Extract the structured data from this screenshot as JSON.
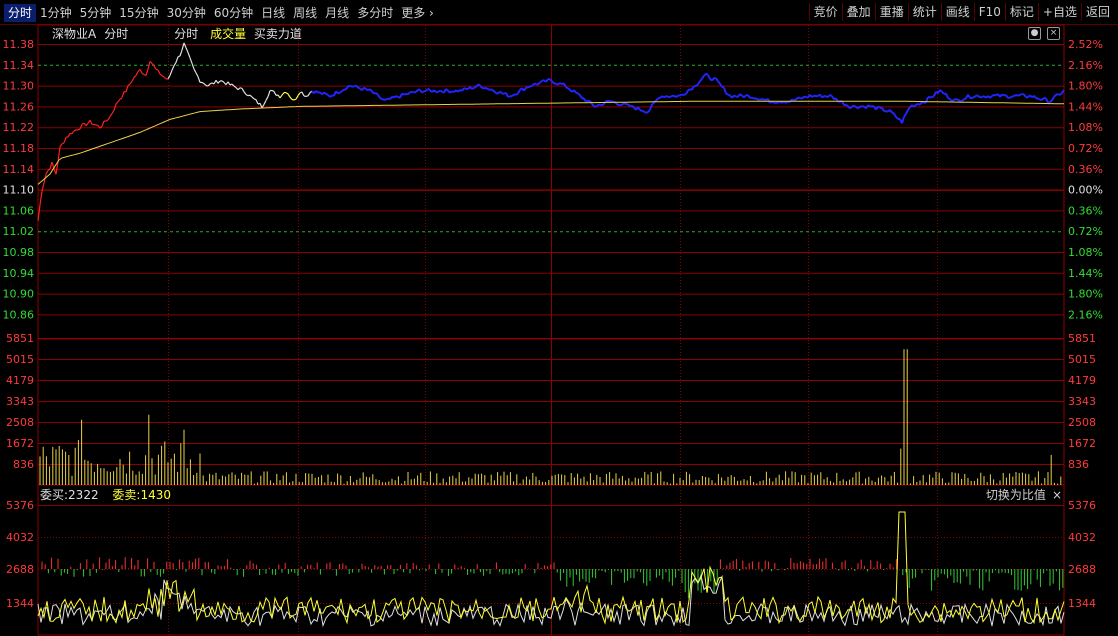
{
  "toolbar": {
    "tabs": [
      "分时",
      "1分钟",
      "5分钟",
      "15分钟",
      "30分钟",
      "60分钟",
      "日线",
      "周线",
      "月线",
      "多分时",
      "更多"
    ],
    "active_tab": 0,
    "right_buttons": [
      "竞价",
      "叠加",
      "重播",
      "统计",
      "画线",
      "F10",
      "标记",
      "+自选",
      "返回"
    ]
  },
  "info": {
    "stock_name": "深物业A",
    "period": "分时",
    "label_period2": "分时",
    "label_volume": "成交量",
    "label_force": "买卖力道"
  },
  "colors": {
    "grid": "#8b0000",
    "dash": "#2ea82e",
    "price_up": "#ff2020",
    "price_flat": "#e0e0e0",
    "price_down": "#2424ff",
    "price_yellow": "#ffff33",
    "avg": "#e8d24a",
    "axis_red": "#ff3b3b",
    "axis_green": "#33dd33",
    "axis_white": "#e0e0e0"
  },
  "price_axis": {
    "left_labels": [
      "11.38",
      "11.34",
      "11.30",
      "11.26",
      "11.22",
      "11.18",
      "11.14",
      "11.10",
      "11.06",
      "11.02",
      "10.98",
      "10.94",
      "10.90",
      "10.86"
    ],
    "right_labels": [
      "2.52%",
      "2.16%",
      "1.80%",
      "1.44%",
      "1.08%",
      "0.72%",
      "0.36%",
      "0.00%",
      "0.36%",
      "0.72%",
      "1.08%",
      "1.44%",
      "1.80%",
      "2.16%"
    ],
    "pre_close": 11.1
  },
  "volume_axis": {
    "labels": [
      "5851",
      "5015",
      "4179",
      "3343",
      "2508",
      "1672",
      "836"
    ]
  },
  "sub_axis": {
    "labels": [
      "5376",
      "4032",
      "2688",
      "1344"
    ]
  },
  "sub_legend": {
    "buy": "委买:2322",
    "sell": "委卖:1430"
  },
  "switch_label": "切换为比值",
  "switch_close": "×"
}
